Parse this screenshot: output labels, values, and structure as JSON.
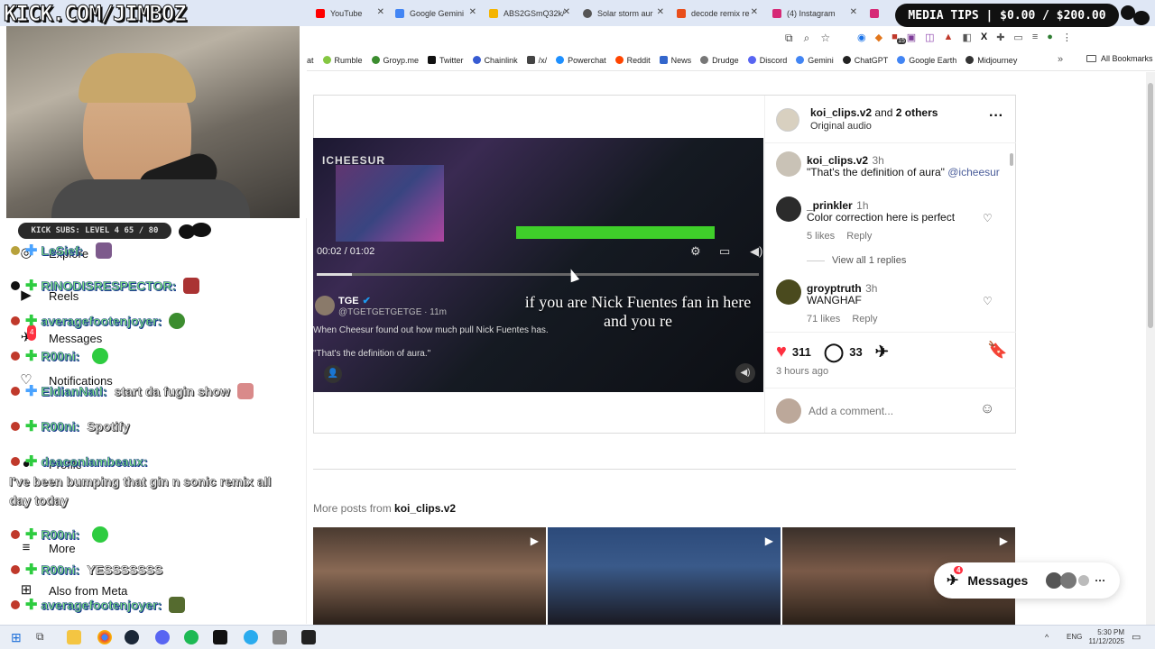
{
  "stream": {
    "logo_text": "KICK.COM/JIMBOZ",
    "media_tips": "MEDIA TIPS | $0.00 / $200.00",
    "kick_subs": "KICK SUBS: LEVEL 4 65 / 80"
  },
  "browser": {
    "tabs": [
      {
        "label": "YouTube",
        "color": "#ff0000"
      },
      {
        "label": "Google Gemini",
        "color": "#4285f4"
      },
      {
        "label": "ABS2GSmQ32k/",
        "color": "#f4b400"
      },
      {
        "label": "Solar storm aur",
        "color": "#555555"
      },
      {
        "label": "decode remix re",
        "color": "#e94e1b"
      },
      {
        "label": "(4) Instagram",
        "color": "#d62976"
      }
    ],
    "bookmarks": [
      {
        "label": "at",
        "color": "#999999"
      },
      {
        "label": "Rumble",
        "color": "#85c742"
      },
      {
        "label": "Groyp.me",
        "color": "#3c8d2f"
      },
      {
        "label": "Twitter",
        "color": "#111111"
      },
      {
        "label": "Chainlink",
        "color": "#375bd2"
      },
      {
        "label": "/x/",
        "color": "#444444"
      },
      {
        "label": "Powerchat",
        "color": "#1e90ff"
      },
      {
        "label": "Reddit",
        "color": "#ff4500"
      },
      {
        "label": "News",
        "color": "#3366cc"
      },
      {
        "label": "Drudge",
        "color": "#777777"
      },
      {
        "label": "Discord",
        "color": "#5865f2"
      },
      {
        "label": "Gemini",
        "color": "#4285f4"
      },
      {
        "label": "ChatGPT",
        "color": "#222222"
      },
      {
        "label": "Google Earth",
        "color": "#4285f4"
      },
      {
        "label": "Midjourney",
        "color": "#333333"
      }
    ],
    "all_bookmarks": "All Bookmarks",
    "ext_badge": "15"
  },
  "nav": {
    "items": [
      "Explore",
      "Reels",
      "Messages",
      "Notifications",
      "Profile",
      "More",
      "Also from Meta"
    ],
    "messages_badge": "4"
  },
  "chat": [
    {
      "user": "LeSief:",
      "msg": ""
    },
    {
      "user": "RINODISRESPECTOR:",
      "msg": ""
    },
    {
      "user": "averagefootenjoyer:",
      "msg": ""
    },
    {
      "user": "R00ni:",
      "msg": ""
    },
    {
      "user": "EldianNatl:",
      "msg": "start da fugin show"
    },
    {
      "user": "R00ni:",
      "msg": "Spotify"
    },
    {
      "user": "deaconlambeaux:",
      "msg": "I've been bumping that gin n sonic remix all day today"
    },
    {
      "user": "R00ni:",
      "msg": ""
    },
    {
      "user": "R00ni:",
      "msg": "YESSSSSSS"
    },
    {
      "user": "averagefootenjoyer:",
      "msg": ""
    }
  ],
  "video": {
    "watermark": "ICHEESUR",
    "time": "00:02 / 01:02",
    "caption": "if you are Nick Fuentes fan in here and you re",
    "tweet_name": "TGE",
    "tweet_handle": "@TGETGETGETGE · 11m",
    "tweet_text": "When Cheesur found out how much pull Nick Fuentes has.",
    "tweet_quote": "\"That's the definition of aura.\""
  },
  "post": {
    "author": "koi_clips.v2",
    "and_text": "and",
    "others": "2 others",
    "audio": "Original audio",
    "comments": [
      {
        "user": "koi_clips.v2",
        "time": "3h",
        "text": "\"That's the definition of aura\"",
        "mention": "@icheesur"
      },
      {
        "user": "_prinkler",
        "time": "1h",
        "text": "Color correction here is perfect",
        "likes": "5 likes",
        "reply": "Reply",
        "view_replies": "View all 1 replies"
      },
      {
        "user": "groyptruth",
        "time": "3h",
        "text": "WANGHAF",
        "likes": "71 likes",
        "reply": "Reply"
      }
    ],
    "like_count": "311",
    "comment_count": "33",
    "posted_ago": "3 hours ago",
    "comment_placeholder": "Add a comment...",
    "more_posts_label": "More posts from",
    "more_posts_user": "koi_clips.v2"
  },
  "messages_pill": {
    "label": "Messages",
    "badge": "4"
  },
  "taskbar": {
    "lang": "ENG",
    "time": "5:30 PM",
    "date": "11/12/2025"
  }
}
